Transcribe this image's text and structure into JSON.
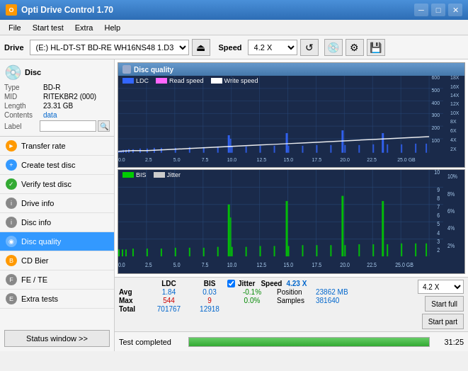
{
  "titleBar": {
    "title": "Opti Drive Control 1.70",
    "minimize": "─",
    "maximize": "□",
    "close": "✕"
  },
  "menuBar": {
    "items": [
      "File",
      "Start test",
      "Extra",
      "Help"
    ]
  },
  "driveToolbar": {
    "driveLabel": "Drive",
    "driveValue": "(E:) HL-DT-ST BD-RE  WH16NS48 1.D3",
    "speedLabel": "Speed",
    "speedValue": "4.2 X"
  },
  "sidebar": {
    "discSection": {
      "type": {
        "label": "Type",
        "value": "BD-R"
      },
      "mid": {
        "label": "MID",
        "value": "RITEKBR2 (000)"
      },
      "length": {
        "label": "Length",
        "value": "23.31 GB"
      },
      "contents": {
        "label": "Contents",
        "value": "data"
      },
      "labelField": {
        "label": "Label",
        "placeholder": ""
      }
    },
    "navItems": [
      {
        "id": "transfer-rate",
        "label": "Transfer rate",
        "iconColor": "orange",
        "active": false
      },
      {
        "id": "create-test-disc",
        "label": "Create test disc",
        "iconColor": "blue",
        "active": false
      },
      {
        "id": "verify-test-disc",
        "label": "Verify test disc",
        "iconColor": "green",
        "active": false
      },
      {
        "id": "drive-info",
        "label": "Drive info",
        "iconColor": "gray",
        "active": false
      },
      {
        "id": "disc-info",
        "label": "Disc info",
        "iconColor": "gray",
        "active": false
      },
      {
        "id": "disc-quality",
        "label": "Disc quality",
        "iconColor": "cyan",
        "active": true
      },
      {
        "id": "cd-bier",
        "label": "CD Bier",
        "iconColor": "orange",
        "active": false
      },
      {
        "id": "fe-te",
        "label": "FE / TE",
        "iconColor": "gray",
        "active": false
      },
      {
        "id": "extra-tests",
        "label": "Extra tests",
        "iconColor": "gray",
        "active": false
      }
    ],
    "statusBtn": "Status window >>"
  },
  "charts": {
    "upper": {
      "title": "Disc quality",
      "legend": [
        {
          "id": "ldc",
          "label": "LDC",
          "color": "#3366ff"
        },
        {
          "id": "read-speed",
          "label": "Read speed",
          "color": "#ff66ff"
        },
        {
          "id": "write-speed",
          "label": "Write speed",
          "color": "#ffffff"
        }
      ],
      "yLeftMax": 600,
      "yRightLabels": [
        "18X",
        "16X",
        "14X",
        "12X",
        "10X",
        "8X",
        "6X",
        "4X",
        "2X"
      ],
      "xLabels": [
        "0.0",
        "2.5",
        "5.0",
        "7.5",
        "10.0",
        "12.5",
        "15.0",
        "17.5",
        "20.0",
        "22.5",
        "25.0 GB"
      ]
    },
    "lower": {
      "title": "",
      "legend": [
        {
          "id": "bis",
          "label": "BIS",
          "color": "#00cc00"
        },
        {
          "id": "jitter",
          "label": "Jitter",
          "color": "#ffffff"
        }
      ],
      "yLeftMax": 10,
      "yRightLabels": [
        "10%",
        "8%",
        "6%",
        "4%",
        "2%"
      ],
      "xLabels": [
        "0.0",
        "2.5",
        "5.0",
        "7.5",
        "10.0",
        "12.5",
        "15.0",
        "17.5",
        "20.0",
        "22.5",
        "25.0 GB"
      ]
    }
  },
  "stats": {
    "columns": [
      "LDC",
      "BIS",
      "",
      "Jitter",
      "Speed",
      "4.23 X"
    ],
    "rows": [
      {
        "label": "Avg",
        "ldc": "1.84",
        "bis": "0.03",
        "jitter": "-0.1%",
        "posLabel": "Position",
        "posValue": "23862 MB"
      },
      {
        "label": "Max",
        "ldc": "544",
        "bis": "9",
        "jitter": "0.0%",
        "samplesLabel": "Samples",
        "samplesValue": "381640"
      },
      {
        "label": "Total",
        "ldc": "701767",
        "bis": "12918",
        "jitter": ""
      }
    ],
    "speedSelect": "4.2 X",
    "startFull": "Start full",
    "startPart": "Start part"
  },
  "progressBar": {
    "label": "Test completed",
    "percent": 100,
    "time": "31:25"
  }
}
